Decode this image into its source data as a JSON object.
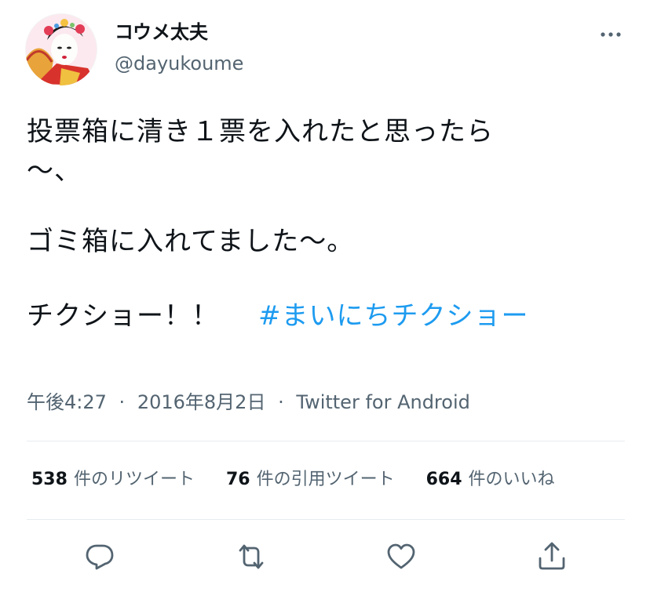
{
  "user": {
    "display_name": "コウメ太夫",
    "handle": "@dayukoume"
  },
  "tweet": {
    "lines": [
      "投票箱に清き１票を入れたと思ったら",
      "〜、",
      "ゴミ箱に入れてました〜。",
      "チクショー！！"
    ],
    "hashtag": "#まいにちチクショー"
  },
  "meta": {
    "time": "午後4:27",
    "date": "2016年8月2日",
    "separator": "·",
    "source": "Twitter for Android"
  },
  "stats": {
    "retweets": {
      "count": "538",
      "label": "件のリツイート"
    },
    "quotes": {
      "count": "76",
      "label": "件の引用ツイート"
    },
    "likes": {
      "count": "664",
      "label": "件のいいね"
    }
  },
  "icons": {
    "more": "more-horizontal-icon",
    "reply": "reply-icon",
    "retweet": "retweet-icon",
    "like": "heart-icon",
    "share": "share-icon"
  },
  "colors": {
    "text": "#0f1419",
    "secondary": "#536471",
    "link": "#1d9bf0",
    "divider": "#e6ecf0"
  }
}
